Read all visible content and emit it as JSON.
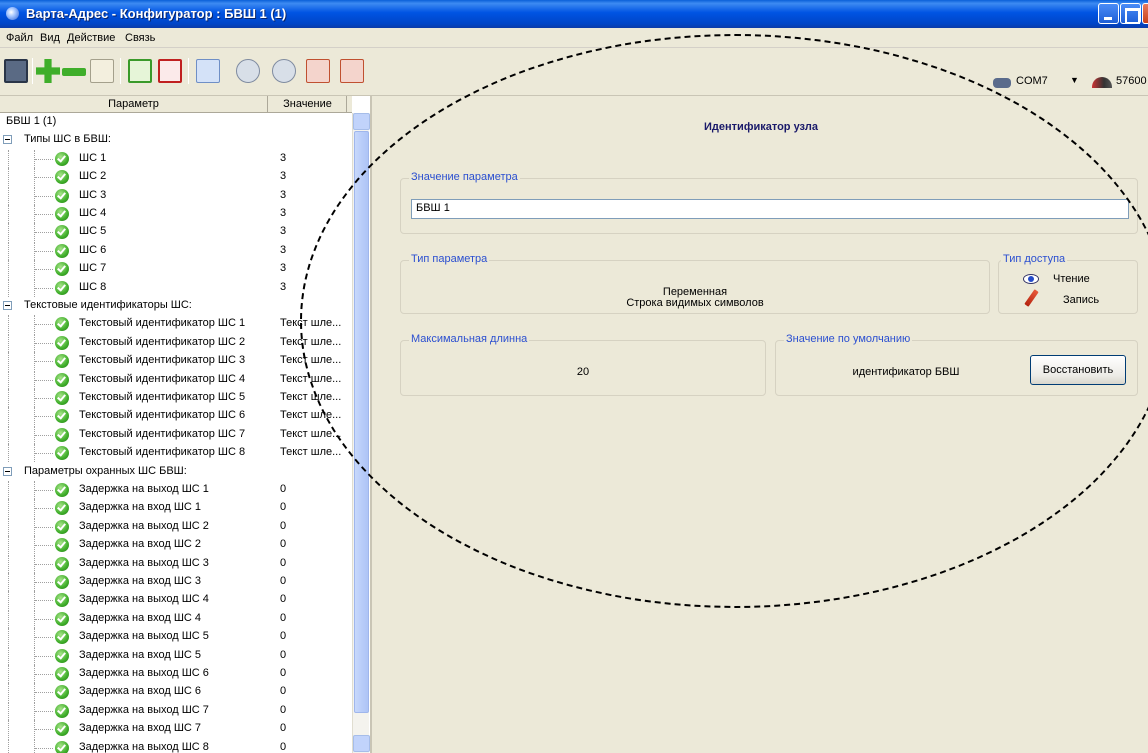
{
  "window": {
    "title": "Варта-Адрес - Конфигуратор : БВШ 1 (1)"
  },
  "menu": [
    "Файл",
    "Вид",
    "Действие",
    "Связь"
  ],
  "toolbar": {
    "port": "COM7",
    "baud": "57600",
    "icons": [
      "save-icon",
      "add-icon",
      "remove-icon",
      "list-icon",
      "check-icon",
      "clear-icon",
      "tree-icon",
      "read-icon",
      "read-all-icon",
      "write-icon",
      "write-all-icon"
    ]
  },
  "tree": {
    "headers": {
      "param": "Параметр",
      "value": "Значение"
    },
    "root": "БВШ 1 (1)",
    "groups": [
      {
        "label": "Типы ШС в БВШ:",
        "items": [
          {
            "label": "ШС 1",
            "value": "3"
          },
          {
            "label": "ШС 2",
            "value": "3"
          },
          {
            "label": "ШС 3",
            "value": "3"
          },
          {
            "label": "ШС 4",
            "value": "3"
          },
          {
            "label": "ШС 5",
            "value": "3"
          },
          {
            "label": "ШС 6",
            "value": "3"
          },
          {
            "label": "ШС 7",
            "value": "3"
          },
          {
            "label": "ШС 8",
            "value": "3"
          }
        ]
      },
      {
        "label": "Текстовые идентификаторы ШС:",
        "items": [
          {
            "label": "Текстовый идентификатор ШС 1",
            "value": "Текст шле..."
          },
          {
            "label": "Текстовый идентификатор ШС 2",
            "value": "Текст шле..."
          },
          {
            "label": "Текстовый идентификатор ШС 3",
            "value": "Текст шле..."
          },
          {
            "label": "Текстовый идентификатор ШС 4",
            "value": "Текст шле..."
          },
          {
            "label": "Текстовый идентификатор ШС 5",
            "value": "Текст шле..."
          },
          {
            "label": "Текстовый идентификатор ШС 6",
            "value": "Текст шле..."
          },
          {
            "label": "Текстовый идентификатор ШС 7",
            "value": "Текст шле..."
          },
          {
            "label": "Текстовый идентификатор ШС 8",
            "value": "Текст шле..."
          }
        ]
      },
      {
        "label": "Параметры охранных ШС БВШ:",
        "items": [
          {
            "label": "Задержка на выход ШС 1",
            "value": "0"
          },
          {
            "label": "Задержка на вход ШС 1",
            "value": "0"
          },
          {
            "label": "Задержка на выход ШС 2",
            "value": "0"
          },
          {
            "label": "Задержка на вход ШС 2",
            "value": "0"
          },
          {
            "label": "Задержка на выход ШС 3",
            "value": "0"
          },
          {
            "label": "Задержка на вход ШС 3",
            "value": "0"
          },
          {
            "label": "Задержка на выход ШС 4",
            "value": "0"
          },
          {
            "label": "Задержка на вход ШС 4",
            "value": "0"
          },
          {
            "label": "Задержка на выход ШС 5",
            "value": "0"
          },
          {
            "label": "Задержка на вход ШС 5",
            "value": "0"
          },
          {
            "label": "Задержка на выход ШС 6",
            "value": "0"
          },
          {
            "label": "Задержка на вход ШС 6",
            "value": "0"
          },
          {
            "label": "Задержка на выход ШС 7",
            "value": "0"
          },
          {
            "label": "Задержка на вход ШС 7",
            "value": "0"
          },
          {
            "label": "Задержка на выход ШС 8",
            "value": "0"
          }
        ]
      }
    ]
  },
  "detail": {
    "node_title": "Идентификатор узла",
    "value_group": {
      "label": "Значение параметра",
      "value": "БВШ 1"
    },
    "type_group": {
      "label": "Тип параметра",
      "line1": "Переменная",
      "line2": "Строка видимых символов"
    },
    "access_group": {
      "label": "Тип доступа",
      "read": "Чтение",
      "write": "Запись"
    },
    "maxlen_group": {
      "label": "Максимальная длинна",
      "value": "20"
    },
    "default_group": {
      "label": "Значение по умолчанию",
      "value": "идентификатор БВШ",
      "restore": "Восстановить"
    }
  }
}
